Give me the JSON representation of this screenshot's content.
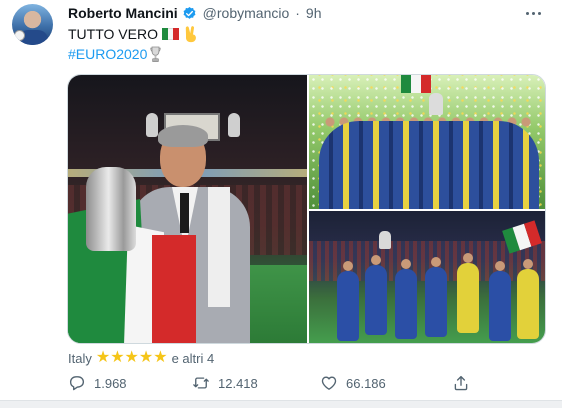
{
  "tweet": {
    "author_name": "Roberto Mancini",
    "handle": "@robymancio",
    "separator": "·",
    "time": "9h",
    "text_line1": "TUTTO VERO",
    "hashtag": "#EURO2020",
    "emojis": [
      "italy-flag",
      "victory-hand",
      "trophy"
    ]
  },
  "reactions": {
    "prefix": "Italy",
    "stars": 5,
    "suffix": "e altri 4"
  },
  "actions": {
    "replies": "1.968",
    "retweets": "12.418",
    "likes": "66.186"
  },
  "colors": {
    "link": "#1d9bf0",
    "verified": "#1d9bf0",
    "secondary_text": "#536471",
    "flag_green": "#1f8a3e",
    "flag_white": "#f5f5f5",
    "flag_red": "#d42a2a"
  },
  "icons": [
    "verified-badge-icon",
    "more-options-icon",
    "reply-icon",
    "retweet-icon",
    "like-icon",
    "share-icon",
    "star-icon"
  ]
}
